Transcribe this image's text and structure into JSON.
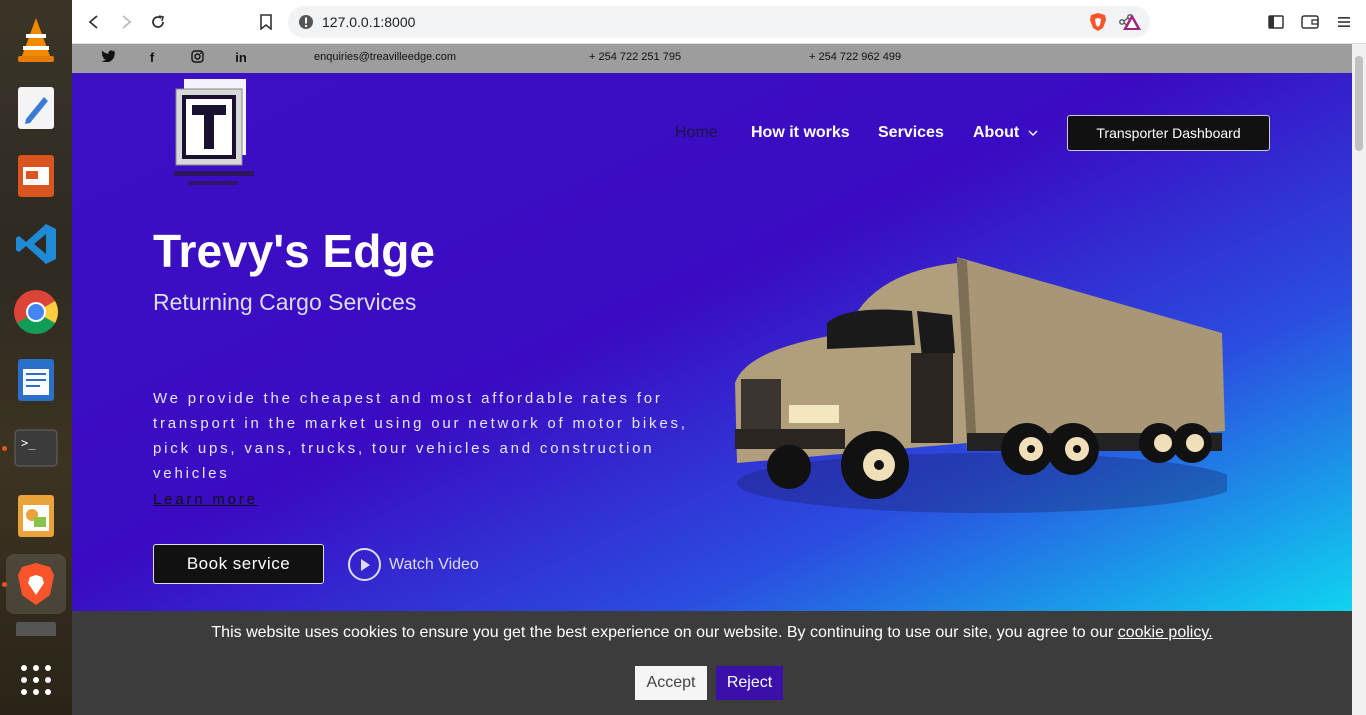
{
  "browser": {
    "url": "127.0.0.1:8000"
  },
  "topbar": {
    "social": [
      "twitter",
      "facebook",
      "instagram",
      "linkedin"
    ],
    "email": "enquiries@treavilleedge.com",
    "phone1": "+ 254 722 251 795",
    "phone2": "+ 254 722 962 499"
  },
  "logo": {
    "letter": "T"
  },
  "nav": {
    "home": "Home",
    "how_it_works": "How it works",
    "services": "Services",
    "about": "About",
    "dashboard": "Transporter Dashboard"
  },
  "hero": {
    "title": "Trevy's Edge",
    "subtitle": "Returning Cargo Services",
    "description": "We provide the cheapest and most affordable rates for transport in the market using our network of motor bikes, pick ups, vans, trucks, tour vehicles and construction vehicles",
    "learn_more": "Learn more",
    "book_button": "Book service",
    "watch_video": "Watch Video"
  },
  "cookie": {
    "text": "This website uses cookies to ensure you get the best experience on our website. By continuing to use our site, you agree to our",
    "link": "cookie policy.",
    "accept": "Accept",
    "reject": "Reject"
  },
  "colors": {
    "hero_start": "#3d10c4",
    "hero_end": "#10d4f0",
    "reject": "#3a10a8"
  }
}
